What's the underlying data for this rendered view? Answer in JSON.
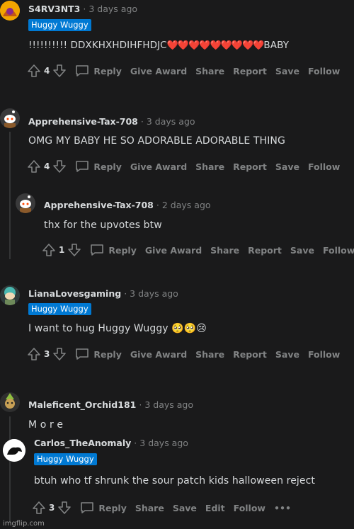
{
  "actions": {
    "reply": "Reply",
    "give_award": "Give Award",
    "share": "Share",
    "report": "Report",
    "save": "Save",
    "follow": "Follow",
    "edit": "Edit",
    "more": "•••"
  },
  "separator": "·",
  "colors": {
    "background": "#1a1a1b",
    "flair": "#0079d3",
    "text": "#d7dadc",
    "muted": "#818384"
  },
  "comments": [
    {
      "author": "S4RV3NT3",
      "time": "3 days ago",
      "flair": "Huggy Wuggy",
      "text_start": "!!!!!!!!!! DDXKHXHDIHFHDJC",
      "hearts": "❤️❤️❤️❤️❤️❤️❤️❤️❤️",
      "text_end": "BABY",
      "score": "4"
    },
    {
      "author": "Apprehensive-Tax-708",
      "time": "3 days ago",
      "text": "OMG MY BABY HE SO ADORABLE ADORABLE THING",
      "score": "4"
    },
    {
      "author": "Apprehensive-Tax-708",
      "time": "2 days ago",
      "text": "thx for the upvotes btw",
      "score": "1"
    },
    {
      "author": "LianaLovesgaming",
      "time": "3 days ago",
      "flair": "Huggy Wuggy",
      "text": "I want to hug Huggy Wuggy 🥺🥺😢",
      "score": "3"
    },
    {
      "author": "Maleficent_Orchid181",
      "time": "3 days ago",
      "text": "M o r e"
    },
    {
      "author": "Carlos_TheAnomaly",
      "time": "3 days ago",
      "flair": "Huggy Wuggy",
      "text": "btuh who tf shrunk the sour patch kids halloween reject",
      "score": "3"
    }
  ],
  "watermark": "imgflip.com"
}
